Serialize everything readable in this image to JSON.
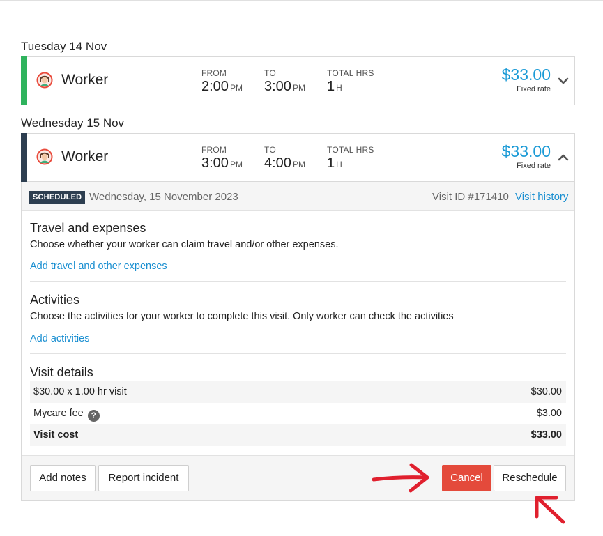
{
  "visits": [
    {
      "date_heading": "Tuesday 14 Nov",
      "worker": "Worker",
      "from_label": "FROM",
      "from_time": "2:00",
      "from_suffix": "PM",
      "to_label": "TO",
      "to_time": "3:00",
      "to_suffix": "PM",
      "total_label": "TOTAL HRS",
      "total_value": "1",
      "total_suffix": "H",
      "price": "$33.00",
      "rate_type": "Fixed rate",
      "stripe_color": "#2fb35d",
      "chevron": "chevron-down-icon"
    },
    {
      "date_heading": "Wednesday 15 Nov",
      "worker": "Worker",
      "from_label": "FROM",
      "from_time": "3:00",
      "from_suffix": "PM",
      "to_label": "TO",
      "to_time": "4:00",
      "to_suffix": "PM",
      "total_label": "TOTAL HRS",
      "total_value": "1",
      "total_suffix": "H",
      "price": "$33.00",
      "rate_type": "Fixed rate",
      "stripe_color": "#2d3e50",
      "chevron": "chevron-up-icon"
    }
  ],
  "details": {
    "status_badge": "SCHEDULED",
    "full_date": "Wednesday, 15 November 2023",
    "visit_id": "Visit ID #171410",
    "visit_history_link": "Visit history",
    "travel": {
      "title": "Travel and expenses",
      "description": "Choose whether your worker can claim travel and/or other expenses.",
      "link": "Add travel and other expenses"
    },
    "activities": {
      "title": "Activities",
      "description": "Choose the activities for your worker to complete this visit. Only worker can check the activities",
      "link": "Add activities"
    },
    "visit_details": {
      "title": "Visit details",
      "rows": [
        {
          "label": "$30.00 x 1.00 hr visit",
          "value": "$30.00"
        },
        {
          "label": "Mycare fee",
          "value": "$3.00",
          "help_icon": "question-circle-icon",
          "help_glyph": "?"
        },
        {
          "label": "Visit cost",
          "value": "$33.00"
        }
      ]
    },
    "buttons": {
      "add_notes": "Add notes",
      "report_incident": "Report incident",
      "cancel": "Cancel",
      "reschedule": "Reschedule"
    }
  },
  "colors": {
    "accent_blue": "#1a9ad6",
    "cancel_red": "#e44a3b",
    "annotation_arrow": "#e0202e"
  }
}
